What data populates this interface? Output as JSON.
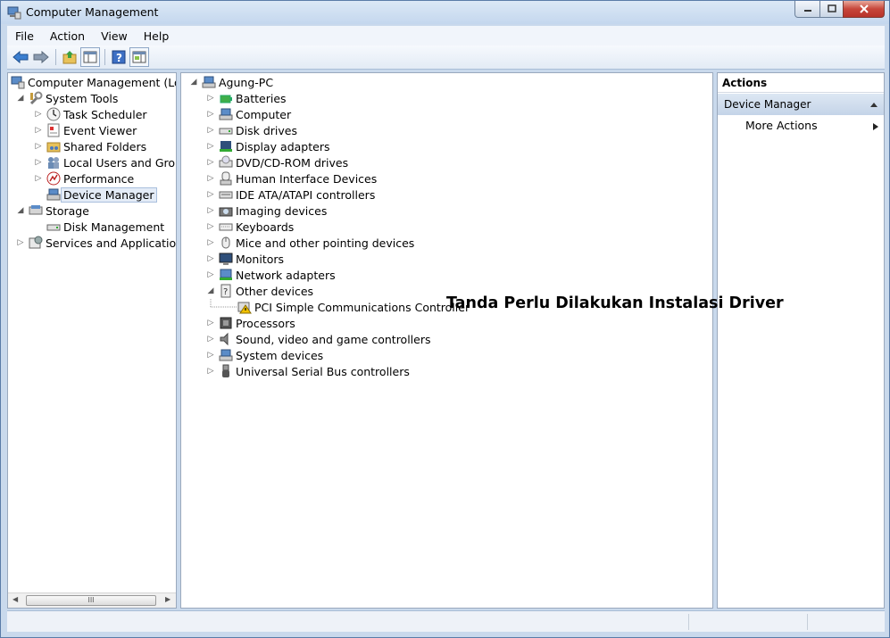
{
  "window": {
    "title": "Computer Management"
  },
  "menu": [
    "File",
    "Action",
    "View",
    "Help"
  ],
  "left_tree": [
    {
      "label": "Computer Management (Local",
      "icon": "computer-management-icon"
    },
    {
      "label": "System Tools",
      "icon": "system-tools-icon"
    },
    {
      "label": "Task Scheduler",
      "icon": "clock-icon"
    },
    {
      "label": "Event Viewer",
      "icon": "event-viewer-icon"
    },
    {
      "label": "Shared Folders",
      "icon": "shared-folder-icon"
    },
    {
      "label": "Local Users and Groups",
      "icon": "users-icon"
    },
    {
      "label": "Performance",
      "icon": "performance-icon"
    },
    {
      "label": "Device Manager",
      "icon": "device-manager-icon"
    },
    {
      "label": "Storage",
      "icon": "storage-icon"
    },
    {
      "label": "Disk Management",
      "icon": "disk-icon"
    },
    {
      "label": "Services and Applications",
      "icon": "services-icon"
    }
  ],
  "scrollbar": {
    "thumb_glyph": "III"
  },
  "device_tree": {
    "root": "Agung-PC",
    "items": [
      "Batteries",
      "Computer",
      "Disk drives",
      "Display adapters",
      "DVD/CD-ROM drives",
      "Human Interface Devices",
      "IDE ATA/ATAPI controllers",
      "Imaging devices",
      "Keyboards",
      "Mice and other pointing devices",
      "Monitors",
      "Network adapters",
      "Other devices",
      "PCI Simple Communications Controller",
      "Processors",
      "Sound, video and game controllers",
      "System devices",
      "Universal Serial Bus controllers"
    ]
  },
  "annotation": "Tanda Perlu Dilakukan Instalasi Driver",
  "actions": {
    "header": "Actions",
    "section": "Device Manager",
    "more": "More Actions"
  },
  "colors": {
    "accent": "#c9d9ec",
    "selection": "#e4ecf7",
    "warning": "#f0c000"
  }
}
